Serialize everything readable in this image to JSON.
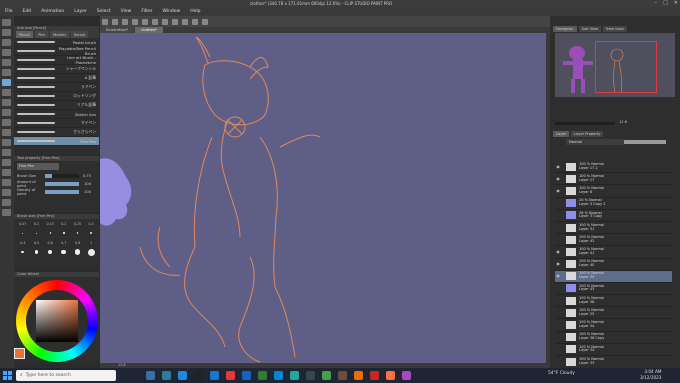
{
  "window": {
    "title": "clothes* (340.78 x 171.01mm 600dpi 12.6%)  - CLIP STUDIO PAINT PRO"
  },
  "menu": [
    "File",
    "Edit",
    "Animation",
    "Layer",
    "Select",
    "View",
    "Filter",
    "Window",
    "Help"
  ],
  "subtool": {
    "header": "Sub tool [Pencil]",
    "tabs": [
      "Pencil",
      "Pen",
      "Marker",
      "Brush"
    ],
    "brushes": [
      {
        "name": "Pastel brush",
        "selected": false
      },
      {
        "name": "Playdate/Bee Pencil Brush",
        "selected": false
      },
      {
        "name": "Line art Brush - Placketche",
        "selected": false
      },
      {
        "name": "シャープペンシル",
        "selected": false
      },
      {
        "name": "A 鉛筆",
        "selected": false
      },
      {
        "name": "ラフペン",
        "selected": false
      },
      {
        "name": "ロットリング",
        "selected": false
      },
      {
        "name": "リアル鉛筆",
        "selected": false
      },
      {
        "name": "Sketch Ans",
        "selected": false
      },
      {
        "name": "マイペン",
        "selected": false
      },
      {
        "name": "さらさらペン",
        "selected": false
      },
      {
        "name": "Fine Pen",
        "selected": true
      }
    ]
  },
  "toolprop": {
    "header": "Tool property [Fine Pen]",
    "brush_name": "Fine Pen",
    "props": [
      {
        "label": "Brush Size",
        "value": "0.75",
        "fill": 0.2
      },
      {
        "label": "Amount of paint",
        "value": "100",
        "fill": 1.0
      },
      {
        "label": "Density of paint",
        "value": "100",
        "fill": 1.0
      }
    ]
  },
  "brushsize": {
    "header": "Brush size [Fine Pen]",
    "sizes": [
      "0.07",
      "0.1",
      "0.15",
      "0.2",
      "0.25",
      "0.3",
      "0.4",
      "0.5",
      "0.6",
      "0.7",
      "0.8",
      "1"
    ]
  },
  "color": {
    "header": "Color Wheel",
    "current": "#e8733a"
  },
  "doc": {
    "tabs": [
      "Illustration*",
      "clothes*"
    ],
    "active": 1,
    "status": "12.6"
  },
  "navigator": {
    "tabs": [
      "Navigator",
      "Sub View",
      "Item bank"
    ],
    "zoom": "12.6"
  },
  "layer_panel": {
    "tabs": [
      "Layer",
      "Layer Property"
    ],
    "blend": "Normal",
    "layers": [
      {
        "name": "100 % Normal\nLayer 17 2",
        "visible": true,
        "selected": false,
        "colored": false
      },
      {
        "name": "100 % Normal\nLayer 17",
        "visible": true,
        "selected": false,
        "colored": false
      },
      {
        "name": "100 % Normal\nLayer 8",
        "visible": true,
        "selected": false,
        "colored": false
      },
      {
        "name": "20 % Normal\nLayer 3 Copy 2",
        "visible": false,
        "selected": false,
        "colored": true
      },
      {
        "name": "26 % Normal\nLayer 3 Copy",
        "visible": false,
        "selected": false,
        "colored": true
      },
      {
        "name": "100 % Normal\nLayer 31",
        "visible": false,
        "selected": false,
        "colored": false
      },
      {
        "name": "100 % Normal\nLayer 42",
        "visible": false,
        "selected": false,
        "colored": false
      },
      {
        "name": "100 % Normal\nLayer 41",
        "visible": true,
        "selected": false,
        "colored": false
      },
      {
        "name": "100 % Normal\nLayer 40",
        "visible": true,
        "selected": false,
        "colored": false
      },
      {
        "name": "100 % Normal\nLayer 39",
        "visible": true,
        "selected": true,
        "colored": false
      },
      {
        "name": "100 % Normal\nLayer 43",
        "visible": false,
        "selected": false,
        "colored": true
      },
      {
        "name": "100 % Normal\nLayer 38",
        "visible": false,
        "selected": false,
        "colored": false
      },
      {
        "name": "100 % Normal\nLayer 25",
        "visible": false,
        "selected": false,
        "colored": false
      },
      {
        "name": "100 % Normal\nLayer 34",
        "visible": false,
        "selected": false,
        "colored": false
      },
      {
        "name": "100 % Normal\nLayer 36 Copy",
        "visible": false,
        "selected": false,
        "colored": false
      },
      {
        "name": "100 % Normal\nLayer 34",
        "visible": false,
        "selected": false,
        "colored": false
      },
      {
        "name": "100 % Normal\nLayer 33",
        "visible": false,
        "selected": false,
        "colored": false
      },
      {
        "name": "100 % Normal\nLayer 32",
        "visible": false,
        "selected": false,
        "colored": false
      }
    ]
  },
  "taskbar": {
    "search_placeholder": "Type here to search",
    "weather": "54°F  Cloudy",
    "time": "3:04 AM",
    "date": "3/12/2023"
  },
  "colors": {
    "canvas": "#5e5e86",
    "sketch": "#e08a5a",
    "accent": "#6fa8dc"
  }
}
